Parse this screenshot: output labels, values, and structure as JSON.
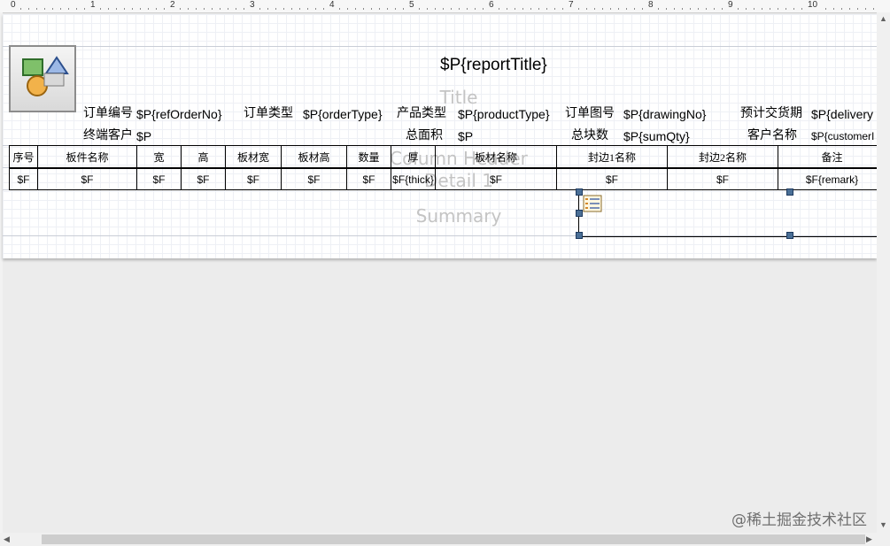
{
  "ruler": {
    "numbers": [
      "0",
      "1",
      "2",
      "3",
      "4",
      "5",
      "6",
      "7",
      "8",
      "9",
      "10"
    ]
  },
  "report": {
    "title_field": "$P{reportTitle}",
    "bands": {
      "title": "Title",
      "column_header": "Column Header",
      "detail": "Detail 1",
      "summary": "Summary"
    },
    "header_fields": [
      {
        "label": "订单编号",
        "value": "$P{refOrderNo}"
      },
      {
        "label": "订单类型",
        "value": "$P{orderType}"
      },
      {
        "label": "产品类型",
        "value": "$P{productType}"
      },
      {
        "label": "订单图号",
        "value": "$P{drawingNo}"
      },
      {
        "label": "预计交货期",
        "value": "$P{delivery"
      },
      {
        "label": "终端客户",
        "value": "$P"
      },
      {
        "label": "总面积",
        "value": "$P"
      },
      {
        "label": "总块数",
        "value": "$P{sumQty}"
      },
      {
        "label": "客户名称",
        "value": "$P{customerI"
      }
    ],
    "columns": [
      "序号",
      "板件名称",
      "宽",
      "高",
      "板材宽",
      "板材高",
      "数量",
      "厚",
      "板材名称",
      "封边1名称",
      "封边2名称",
      "备注"
    ],
    "detail": [
      "$F",
      "$F",
      "$F",
      "$F",
      "$F",
      "$F",
      "$F",
      "$F{thick}",
      "$F",
      "$F",
      "$F",
      "$F{remark}"
    ]
  },
  "icons": {
    "logo": "image-element-icon",
    "subreport": "subreport-icon",
    "vscroll_up": "arrow-up-icon",
    "vscroll_down": "arrow-down-icon",
    "hscroll_left": "arrow-left-icon",
    "hscroll_right": "arrow-right-icon"
  },
  "watermark": "@稀土掘金技术社区",
  "colors": {
    "handle": "#4a6f96",
    "grid": "#eef0f5",
    "band_text": "#c4c4c4"
  }
}
